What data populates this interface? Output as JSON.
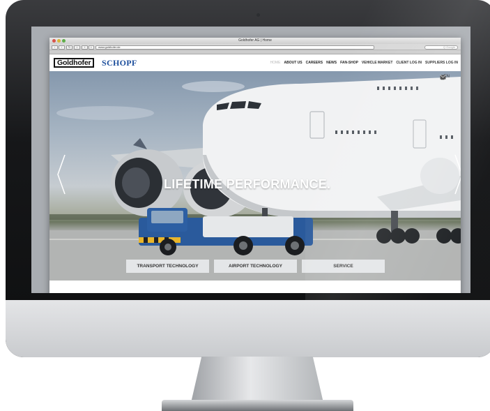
{
  "browser": {
    "window_title": "Goldhofer AG | Home",
    "url": "www.goldhofer.de",
    "search_placeholder": "Q  Google"
  },
  "brand": {
    "logo_primary": "Goldhofer",
    "logo_secondary": "SCHOPF",
    "schopf_color": "#1c4e9c"
  },
  "nav": {
    "items": [
      "HOME",
      "ABOUT US",
      "CAREERS",
      "NEWS",
      "FAN-SHOP",
      "VEHICLE MARKET",
      "CLIENT LOG IN",
      "SUPPLIERS LOG IN"
    ]
  },
  "hero": {
    "headline": "LIFETIME PERFORMANCE.",
    "language": "EN",
    "icons": [
      "home-icon",
      "mail-icon",
      "chevron-left-icon",
      "chevron-right-icon"
    ],
    "buttons": [
      "TRANSPORT TECHNOLOGY",
      "AIRPORT TECHNOLOGY",
      "SERVICE"
    ]
  }
}
